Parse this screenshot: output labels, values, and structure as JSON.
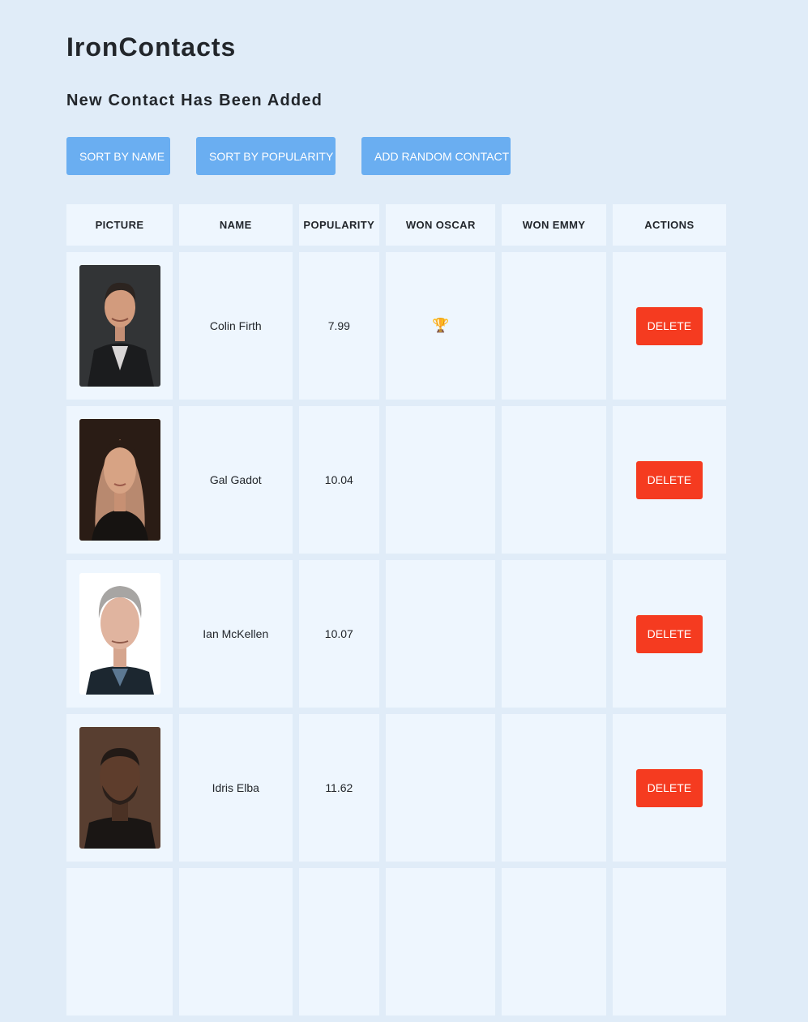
{
  "app": {
    "title": "IronContacts",
    "status_message": "New Contact Has Been Added"
  },
  "toolbar": {
    "sort_by_name": "SORT BY NAME",
    "sort_by_popularity": "SORT BY POPULARITY",
    "add_random_contact": "ADD RANDOM CONTACT"
  },
  "table": {
    "headers": [
      "PICTURE",
      "NAME",
      "POPULARITY",
      "WON OSCAR",
      "WON EMMY",
      "ACTIONS"
    ],
    "rows": [
      {
        "name": "Colin Firth",
        "popularity": "7.99",
        "won_oscar": "🏆",
        "won_emmy": "",
        "action": "DELETE",
        "photo_icon": "man-portrait-dark-suit"
      },
      {
        "name": "Gal Gadot",
        "popularity": "10.04",
        "won_oscar": "",
        "won_emmy": "",
        "action": "DELETE",
        "photo_icon": "woman-portrait-dark-hair"
      },
      {
        "name": "Ian McKellen",
        "popularity": "10.07",
        "won_oscar": "",
        "won_emmy": "",
        "action": "DELETE",
        "photo_icon": "man-portrait-grey-hair"
      },
      {
        "name": "Idris Elba",
        "popularity": "11.62",
        "won_oscar": "",
        "won_emmy": "",
        "action": "DELETE",
        "photo_icon": "man-portrait-beard"
      }
    ]
  },
  "colors": {
    "background": "#e0ecf8",
    "cell_background": "#eef6fe",
    "primary_button": "#6aaef1",
    "delete_button": "#f53b20"
  }
}
